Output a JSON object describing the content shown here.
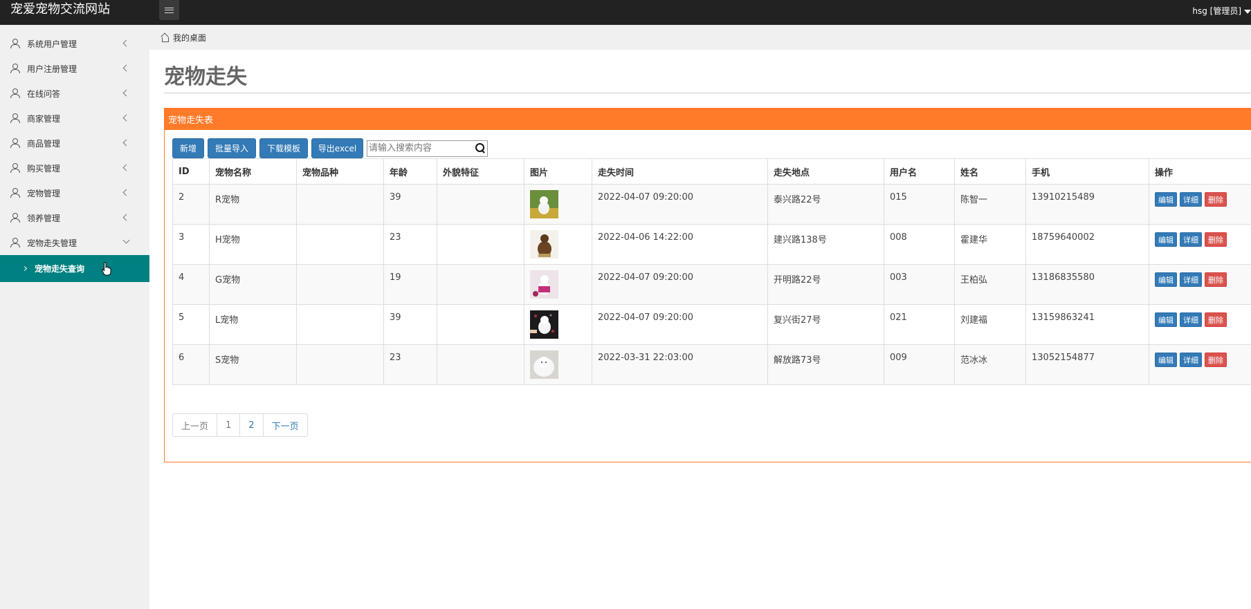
{
  "header": {
    "brand": "宠爱宠物交流网站",
    "user": "hsg [管理员]",
    "menu_toggle_icon": "hamburger-icon"
  },
  "sidebar": {
    "items": [
      {
        "label": "系统用户管理",
        "icon": "user-icon"
      },
      {
        "label": "用户注册管理",
        "icon": "user-icon"
      },
      {
        "label": "在线问答",
        "icon": "user-icon"
      },
      {
        "label": "商家管理",
        "icon": "user-icon"
      },
      {
        "label": "商品管理",
        "icon": "user-icon"
      },
      {
        "label": "购买管理",
        "icon": "user-icon"
      },
      {
        "label": "宠物管理",
        "icon": "user-icon"
      },
      {
        "label": "领养管理",
        "icon": "user-icon"
      },
      {
        "label": "宠物走失管理",
        "icon": "user-icon",
        "expanded": true
      }
    ],
    "active_sub": "宠物走失查询",
    "active_color": "#008080"
  },
  "breadcrumb": {
    "home": "我的桌面"
  },
  "page": {
    "title": "宠物走失"
  },
  "panel": {
    "title": "宠物走失表",
    "accent": "#ff7a29"
  },
  "toolbar": {
    "add": "新增",
    "import": "批量导入",
    "template": "下载模板",
    "export": "导出excel",
    "search_placeholder": "请输入搜索内容"
  },
  "table": {
    "headers": [
      "ID",
      "宠物名称",
      "宠物品种",
      "年龄",
      "外貌特征",
      "图片",
      "走失时间",
      "走失地点",
      "用户名",
      "姓名",
      "手机",
      "操作"
    ],
    "rows": [
      {
        "id": "2",
        "name": "R宠物",
        "breed": "",
        "age": "39",
        "features": "",
        "time": "2022-04-07 09:20:00",
        "place": "泰兴路22号",
        "username": "015",
        "realname": "陈智一",
        "phone": "13910215489"
      },
      {
        "id": "3",
        "name": "H宠物",
        "breed": "",
        "age": "23",
        "features": "",
        "time": "2022-04-06 14:22:00",
        "place": "建兴路138号",
        "username": "008",
        "realname": "霍建华",
        "phone": "18759640002"
      },
      {
        "id": "4",
        "name": "G宠物",
        "breed": "",
        "age": "19",
        "features": "",
        "time": "2022-04-07 09:20:00",
        "place": "开明路22号",
        "username": "003",
        "realname": "王柏弘",
        "phone": "13186835580"
      },
      {
        "id": "5",
        "name": "L宠物",
        "breed": "",
        "age": "39",
        "features": "",
        "time": "2022-04-07 09:20:00",
        "place": "复兴街27号",
        "username": "021",
        "realname": "刘建福",
        "phone": "13159863241"
      },
      {
        "id": "6",
        "name": "S宠物",
        "breed": "",
        "age": "23",
        "features": "",
        "time": "2022-03-31 22:03:00",
        "place": "解放路73号",
        "username": "009",
        "realname": "范冰冰",
        "phone": "13052154877"
      }
    ],
    "actions": {
      "edit": "编辑",
      "detail": "详细",
      "delete": "删除"
    }
  },
  "pagination": {
    "prev": "上一页",
    "pages": [
      "1",
      "2"
    ],
    "next": "下一页"
  }
}
